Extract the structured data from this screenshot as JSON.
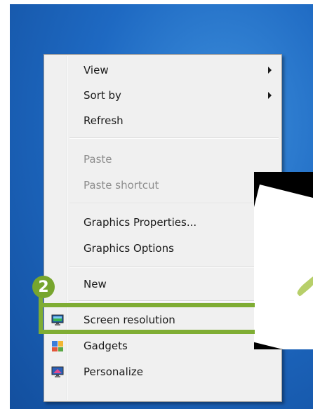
{
  "context_menu": {
    "items": [
      {
        "label": "View",
        "has_submenu": true,
        "disabled": false
      },
      {
        "label": "Sort by",
        "has_submenu": true,
        "disabled": false
      },
      {
        "label": "Refresh",
        "has_submenu": false,
        "disabled": false
      },
      {
        "label": "Paste",
        "has_submenu": false,
        "disabled": true
      },
      {
        "label": "Paste shortcut",
        "has_submenu": false,
        "disabled": true
      },
      {
        "label": "Graphics Properties...",
        "has_submenu": false,
        "disabled": false
      },
      {
        "label": "Graphics Options",
        "has_submenu": false,
        "disabled": false
      },
      {
        "label": "New",
        "has_submenu": false,
        "disabled": false
      },
      {
        "label": "Screen resolution",
        "has_submenu": false,
        "disabled": false,
        "icon": "monitor-icon"
      },
      {
        "label": "Gadgets",
        "has_submenu": false,
        "disabled": false,
        "icon": "gadgets-icon"
      },
      {
        "label": "Personalize",
        "has_submenu": false,
        "disabled": false,
        "icon": "personalize-icon"
      }
    ]
  },
  "annotation": {
    "step_number": "2",
    "highlight_color": "#7fad33"
  },
  "colors": {
    "desktop_blue": "#1e69c2",
    "menu_background": "#f0f0f0"
  }
}
